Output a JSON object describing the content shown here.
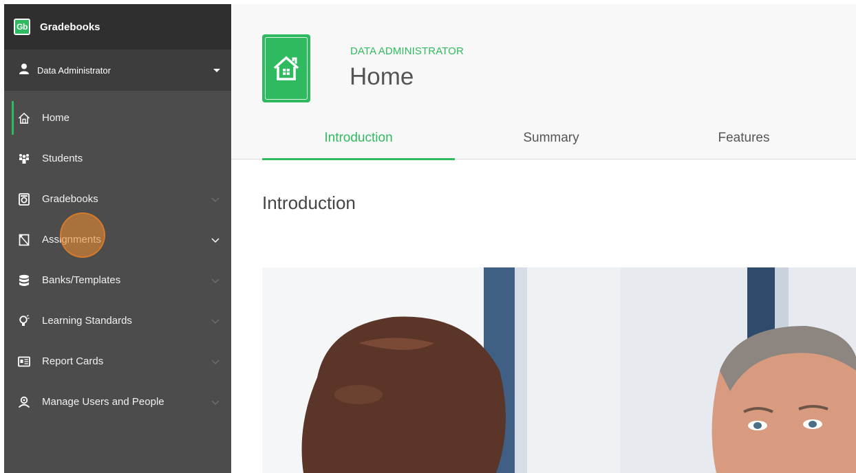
{
  "brand": {
    "logo_text": "Gb",
    "name": "Gradebooks"
  },
  "user": {
    "name": "Data Administrator"
  },
  "nav": {
    "items": [
      {
        "label": "Home",
        "icon": "home-icon",
        "active": true,
        "expandable": false
      },
      {
        "label": "Students",
        "icon": "students-icon",
        "expandable": false
      },
      {
        "label": "Gradebooks",
        "icon": "gradebook-icon",
        "expandable": true
      },
      {
        "label": "Assignments",
        "icon": "assignment-icon",
        "expandable": true
      },
      {
        "label": "Banks/Templates",
        "icon": "database-icon",
        "expandable": true
      },
      {
        "label": "Learning Standards",
        "icon": "lightbulb-icon",
        "expandable": true
      },
      {
        "label": "Report Cards",
        "icon": "report-card-icon",
        "expandable": true
      },
      {
        "label": "Manage Users and People",
        "icon": "manage-users-icon",
        "expandable": true
      }
    ]
  },
  "header": {
    "role": "DATA ADMINISTRATOR",
    "title": "Home",
    "badge_icon": "home-icon"
  },
  "tabs": [
    {
      "label": "Introduction",
      "active": true
    },
    {
      "label": "Summary"
    },
    {
      "label": "Features"
    }
  ],
  "content": {
    "section_title": "Introduction"
  },
  "colors": {
    "accent": "#2fba5f",
    "sidebar": "#4c4c4c",
    "sidebar_dark": "#2f2f2f",
    "cursor": "#e88c34"
  }
}
